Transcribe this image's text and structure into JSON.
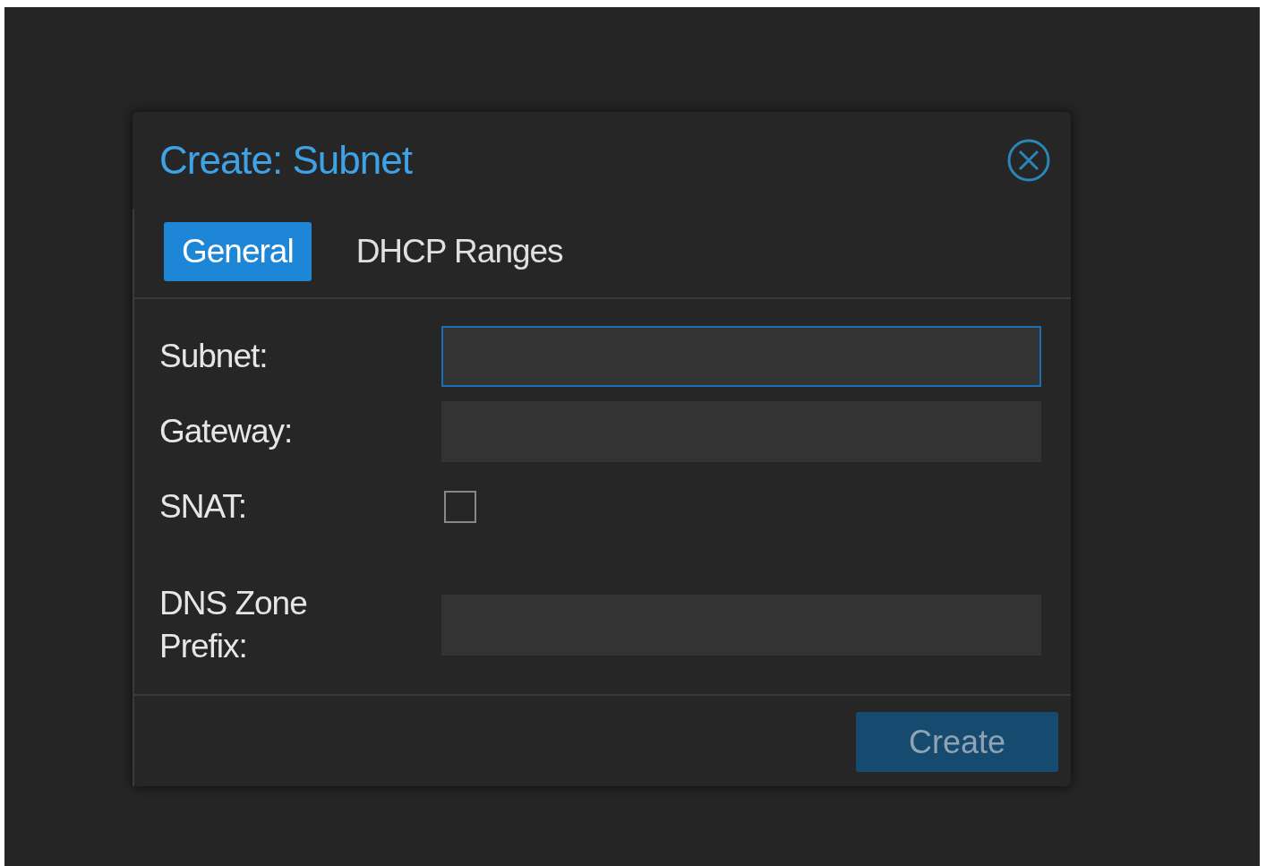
{
  "dialog": {
    "title": "Create: Subnet"
  },
  "tabs": [
    {
      "label": "General",
      "selected": true
    },
    {
      "label": "DHCP Ranges",
      "selected": false
    }
  ],
  "fields": [
    {
      "kind": "text",
      "label": "Subnet:",
      "focused": true
    },
    {
      "kind": "text",
      "label": "Gateway:",
      "focused": false
    },
    {
      "kind": "checkbox",
      "label": "SNAT:",
      "checked": false
    },
    {
      "kind": "text",
      "label": "DNS Zone Prefix:",
      "focused": false
    }
  ],
  "buttons": [
    {
      "label": "Create",
      "disabled": true
    }
  ]
}
